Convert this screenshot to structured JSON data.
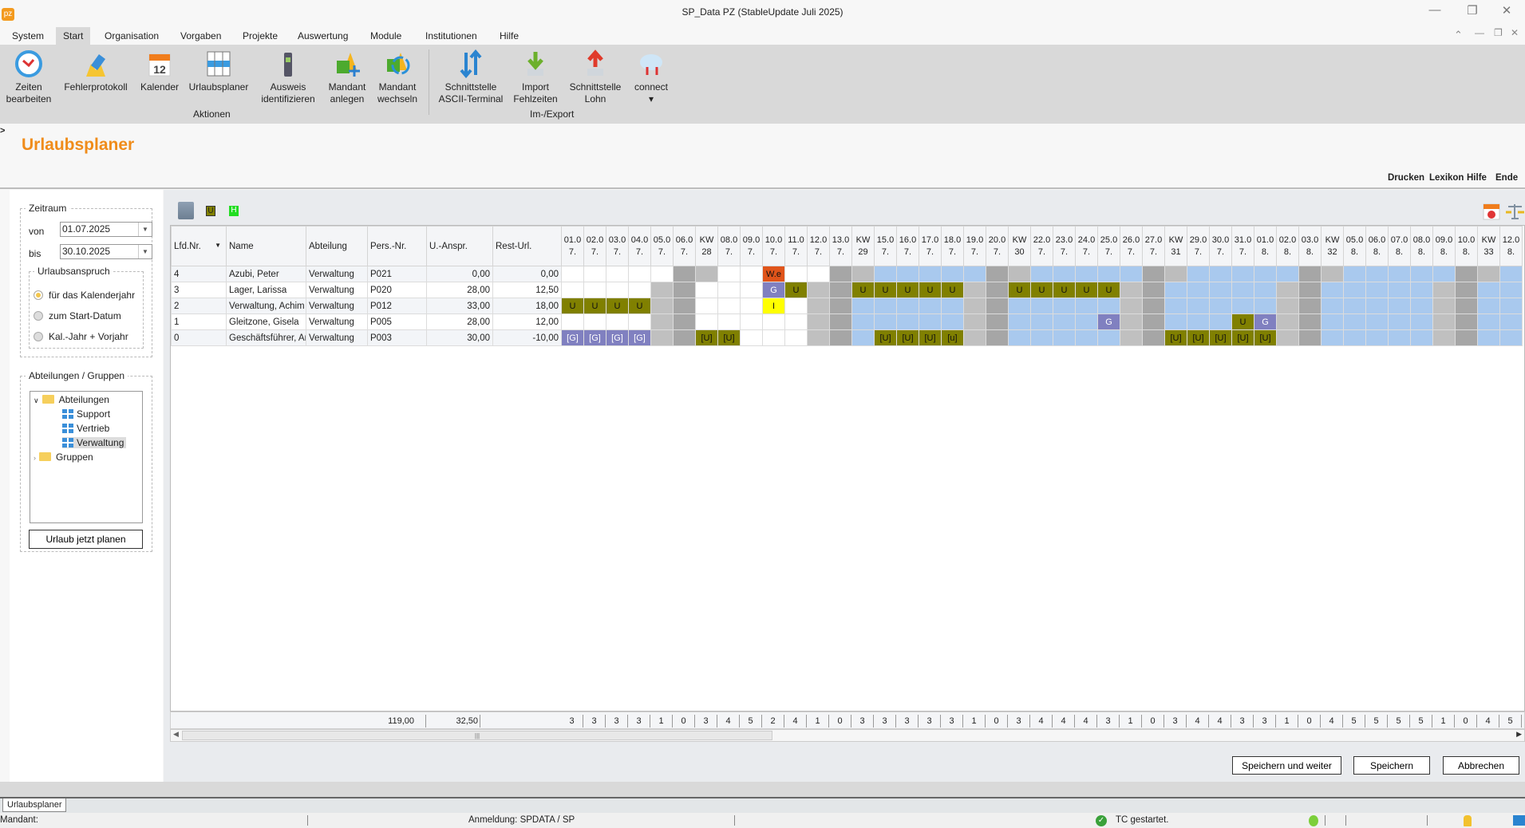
{
  "window": {
    "title": "SP_Data PZ (StableUpdate Juli 2025)",
    "logo": "pz",
    "min": "—",
    "restore": "❐",
    "close": "✕",
    "up": "⌃"
  },
  "menu": [
    "System",
    "Start",
    "Organisation",
    "Vorgaben",
    "Projekte",
    "Auswertung",
    "Module",
    "Institutionen",
    "Hilfe"
  ],
  "ribbon": {
    "buttons": [
      {
        "l1": "Zeiten",
        "l2": "bearbeiten",
        "icon": "clock-icon"
      },
      {
        "l1": "Fehlerprotokoll",
        "l2": "",
        "icon": "eraser-icon"
      },
      {
        "l1": "Kalender",
        "l2": "",
        "icon": "calendar-icon"
      },
      {
        "l1": "Urlaubsplaner",
        "l2": "",
        "icon": "planner-icon"
      },
      {
        "l1": "Ausweis",
        "l2": "identifizieren",
        "icon": "terminal-icon"
      },
      {
        "l1": "Mandant",
        "l2": "anlegen",
        "icon": "add-client-icon"
      },
      {
        "l1": "Mandant",
        "l2": "wechseln",
        "icon": "switch-client-icon"
      },
      {
        "l1": "Schnittstelle",
        "l2": "ASCII-Terminal",
        "icon": "updown-arrows-icon"
      },
      {
        "l1": "Import",
        "l2": "Fehlzeiten",
        "icon": "import-icon"
      },
      {
        "l1": "Schnittstelle",
        "l2": "Lohn",
        "icon": "export-icon"
      },
      {
        "l1": "connect",
        "l2": "▾",
        "icon": "cloud-icon"
      }
    ],
    "groups": [
      "Aktionen",
      "Im-/Export"
    ]
  },
  "page": {
    "title": "Urlaubsplaner",
    "links": [
      "Drucken",
      "Lexikon",
      "Hilfe",
      "Ende"
    ]
  },
  "left": {
    "zeitraum": "Zeitraum",
    "von_label": "von",
    "von": "01.07.2025",
    "bis_label": "bis",
    "bis": "30.10.2025",
    "anspruch": "Urlaubsanspruch",
    "radios": [
      {
        "label": "für das Kalenderjahr",
        "checked": true
      },
      {
        "label": "zum Start-Datum",
        "checked": false
      },
      {
        "label": "Kal.-Jahr + Vorjahr",
        "checked": false
      }
    ],
    "groups_title": "Abteilungen / Gruppen",
    "tree": {
      "root": "Abteilungen",
      "children": [
        "Support",
        "Vertrieb",
        "Verwaltung"
      ],
      "selected": "Verwaltung",
      "root2": "Gruppen"
    },
    "plan_button": "Urlaub jetzt planen"
  },
  "toolbar": {
    "u_badge": "U",
    "h_badge": "H"
  },
  "grid": {
    "columns": [
      "Lfd.Nr.",
      "Name",
      "Abteilung",
      "Pers.-Nr.",
      "U.-Anspr.",
      "Rest-Url."
    ],
    "days": [
      {
        "a": "01.0",
        "b": "7.",
        "k": "d"
      },
      {
        "a": "02.0",
        "b": "7.",
        "k": "d"
      },
      {
        "a": "03.0",
        "b": "7.",
        "k": "d"
      },
      {
        "a": "04.0",
        "b": "7.",
        "k": "d"
      },
      {
        "a": "05.0",
        "b": "7.",
        "k": "sat"
      },
      {
        "a": "06.0",
        "b": "7.",
        "k": "sun"
      },
      {
        "a": "KW",
        "b": "28",
        "k": "kw"
      },
      {
        "a": "08.0",
        "b": "7.",
        "k": "d"
      },
      {
        "a": "09.0",
        "b": "7.",
        "k": "d"
      },
      {
        "a": "10.0",
        "b": "7.",
        "k": "d"
      },
      {
        "a": "11.0",
        "b": "7.",
        "k": "d"
      },
      {
        "a": "12.0",
        "b": "7.",
        "k": "sat"
      },
      {
        "a": "13.0",
        "b": "7.",
        "k": "sun"
      },
      {
        "a": "KW",
        "b": "29",
        "k": "kw"
      },
      {
        "a": "15.0",
        "b": "7.",
        "k": "d"
      },
      {
        "a": "16.0",
        "b": "7.",
        "k": "d"
      },
      {
        "a": "17.0",
        "b": "7.",
        "k": "d"
      },
      {
        "a": "18.0",
        "b": "7.",
        "k": "d"
      },
      {
        "a": "19.0",
        "b": "7.",
        "k": "sat"
      },
      {
        "a": "20.0",
        "b": "7.",
        "k": "sun"
      },
      {
        "a": "KW",
        "b": "30",
        "k": "kw"
      },
      {
        "a": "22.0",
        "b": "7.",
        "k": "d"
      },
      {
        "a": "23.0",
        "b": "7.",
        "k": "d"
      },
      {
        "a": "24.0",
        "b": "7.",
        "k": "d"
      },
      {
        "a": "25.0",
        "b": "7.",
        "k": "d"
      },
      {
        "a": "26.0",
        "b": "7.",
        "k": "sat"
      },
      {
        "a": "27.0",
        "b": "7.",
        "k": "sun"
      },
      {
        "a": "KW",
        "b": "31",
        "k": "kw"
      },
      {
        "a": "29.0",
        "b": "7.",
        "k": "d"
      },
      {
        "a": "30.0",
        "b": "7.",
        "k": "d"
      },
      {
        "a": "31.0",
        "b": "7.",
        "k": "d"
      },
      {
        "a": "01.0",
        "b": "8.",
        "k": "d"
      },
      {
        "a": "02.0",
        "b": "8.",
        "k": "sat"
      },
      {
        "a": "03.0",
        "b": "8.",
        "k": "sun"
      },
      {
        "a": "KW",
        "b": "32",
        "k": "kw"
      },
      {
        "a": "05.0",
        "b": "8.",
        "k": "d"
      },
      {
        "a": "06.0",
        "b": "8.",
        "k": "d"
      },
      {
        "a": "07.0",
        "b": "8.",
        "k": "d"
      },
      {
        "a": "08.0",
        "b": "8.",
        "k": "d"
      },
      {
        "a": "09.0",
        "b": "8.",
        "k": "sat"
      },
      {
        "a": "10.0",
        "b": "8.",
        "k": "sun"
      },
      {
        "a": "KW",
        "b": "33",
        "k": "kw"
      },
      {
        "a": "12.0",
        "b": "8.",
        "k": "d"
      }
    ],
    "rows": [
      {
        "nr": "4",
        "name": "Azubi, Peter",
        "abt": "Verwaltung",
        "pers": "P021",
        "ansp": "0,00",
        "rest": "0,00",
        "satwork": true,
        "cells": {
          "9": "W.e"
        }
      },
      {
        "nr": "3",
        "name": "Lager, Larissa",
        "abt": "Verwaltung",
        "pers": "P020",
        "ansp": "28,00",
        "rest": "12,50",
        "cells": {
          "9": "G",
          "10": "U",
          "13": "U",
          "14": "U",
          "15": "U",
          "16": "U",
          "17": "U",
          "20": "U",
          "21": "U",
          "22": "U",
          "23": "U",
          "24": "U"
        }
      },
      {
        "nr": "2",
        "name": "Verwaltung, Achim",
        "abt": "Verwaltung",
        "pers": "P012",
        "ansp": "33,00",
        "rest": "18,00",
        "cells": {
          "0": "U",
          "1": "U",
          "2": "U",
          "3": "U",
          "9": "I"
        }
      },
      {
        "nr": "1",
        "name": "Gleitzone, Gisela",
        "abt": "Verwaltung",
        "pers": "P005",
        "ansp": "28,00",
        "rest": "12,00",
        "cells": {
          "24": "G",
          "30": "U",
          "31": "G"
        }
      },
      {
        "nr": "0",
        "name": "Geschäftsführer, Anton",
        "abt": "Verwaltung",
        "pers": "P003",
        "ansp": "30,00",
        "rest": "-10,00",
        "cells": {
          "0": "[G]",
          "1": "[G]",
          "2": "[G]",
          "3": "[G]",
          "6": "[U]",
          "7": "[U]",
          "14": "[U]",
          "15": "[U]",
          "16": "[U]",
          "17": "[u]",
          "27": "[U]",
          "28": "[U]",
          "29": "[U]",
          "30": "[U]",
          "31": "[U]"
        }
      }
    ],
    "footer": {
      "ansp": "119,00",
      "rest": "32,50",
      "counts": [
        "3",
        "3",
        "3",
        "3",
        "1",
        "0",
        "3",
        "4",
        "5",
        "2",
        "4",
        "1",
        "0",
        "3",
        "3",
        "3",
        "3",
        "3",
        "1",
        "0",
        "3",
        "4",
        "4",
        "4",
        "3",
        "1",
        "0",
        "3",
        "4",
        "4",
        "3",
        "3",
        "1",
        "0",
        "4",
        "5",
        "5",
        "5",
        "5",
        "1",
        "0",
        "4",
        "5"
      ]
    },
    "colors": {
      "U": "#808000",
      "G": "#8080c0",
      "W.e": "#e0541a",
      "I": "#ffff00",
      "blue": "#a9c9ee",
      "sat": "#c0c0c0",
      "sun": "#a6a6a6",
      "kw_gray": "#bdbdbd",
      "white": "#ffffff"
    }
  },
  "buttons": {
    "save_next": "Speichern und weiter",
    "save": "Speichern",
    "cancel": "Abbrechen"
  },
  "tabs": [
    "Urlaubsplaner"
  ],
  "status": {
    "mandant": "Mandant:",
    "anmeldung": "Anmeldung:  SPDATA / SP",
    "tc": "TC gestartet."
  }
}
